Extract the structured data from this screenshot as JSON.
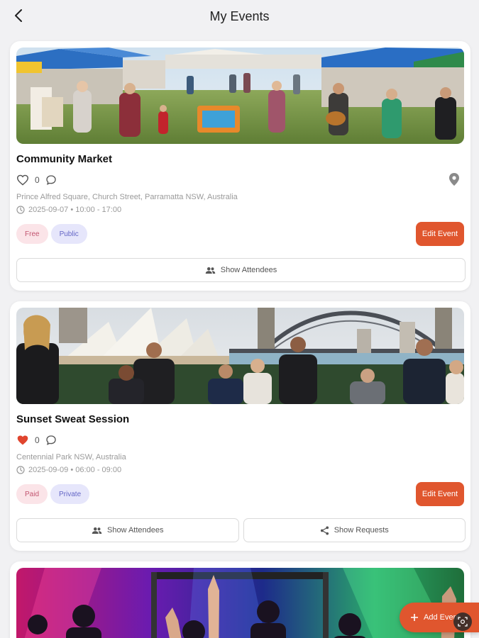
{
  "header": {
    "title": "My Events"
  },
  "events": [
    {
      "title": "Community Market",
      "comments": "0",
      "liked": false,
      "address": "Prince Alfred Square, Church Street, Parramatta NSW, Australia",
      "datetime": "2025-09-07 • 10:00 - 17:00",
      "tags": [
        "Free",
        "Public"
      ],
      "edit_label": "Edit Event",
      "show_attendees_label": "Show Attendees"
    },
    {
      "title": "Sunset Sweat Session",
      "comments": "0",
      "liked": true,
      "address": "Centennial Park NSW, Australia",
      "datetime": "2025-09-09 • 06:00 - 09:00",
      "tags": [
        "Paid",
        "Private"
      ],
      "edit_label": "Edit Event",
      "show_attendees_label": "Show Attendees",
      "show_requests_label": "Show Requests"
    }
  ],
  "fab": {
    "label": "Add Event"
  },
  "colors": {
    "accent": "#e0562e",
    "liked_heart": "#e0452e",
    "tag_pink_bg": "#fbe4e8",
    "tag_lavender_bg": "#e6e6fb"
  },
  "icons": {
    "back": "chevron-left-icon",
    "like": "heart-icon",
    "comment": "comment-bubble-icon",
    "location": "map-pin-icon",
    "time": "clock-icon",
    "attendees": "people-icon",
    "requests": "share-icon",
    "add": "plus-icon",
    "scan": "scan-icon"
  }
}
